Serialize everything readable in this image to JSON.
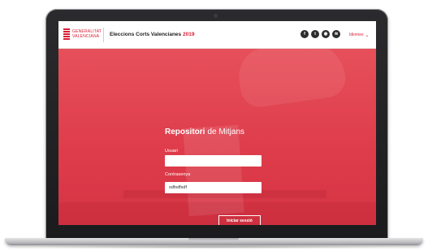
{
  "header": {
    "logo_lines": [
      "GENERALITAT",
      "VALENCIANA"
    ],
    "title": "Eleccions Corts Valencianes",
    "title_year": "2019",
    "social": [
      {
        "icon": "facebook-icon",
        "glyph": "f"
      },
      {
        "icon": "twitter-icon",
        "glyph": "t"
      },
      {
        "icon": "instagram-icon",
        "glyph": "◉"
      },
      {
        "icon": "rss-icon",
        "glyph": "≋"
      }
    ],
    "language": "Idiomes"
  },
  "login": {
    "title_bold": "Repositori",
    "title_rest": "de Mitjans",
    "user_label": "Usuari",
    "user_value": "",
    "password_label": "Contrasenya",
    "password_value": "sdfsdfsdf",
    "submit_label": "Iniciar sessió"
  },
  "colors": {
    "brand_red": "#d81e34",
    "hero_red": "#df3d4b"
  }
}
